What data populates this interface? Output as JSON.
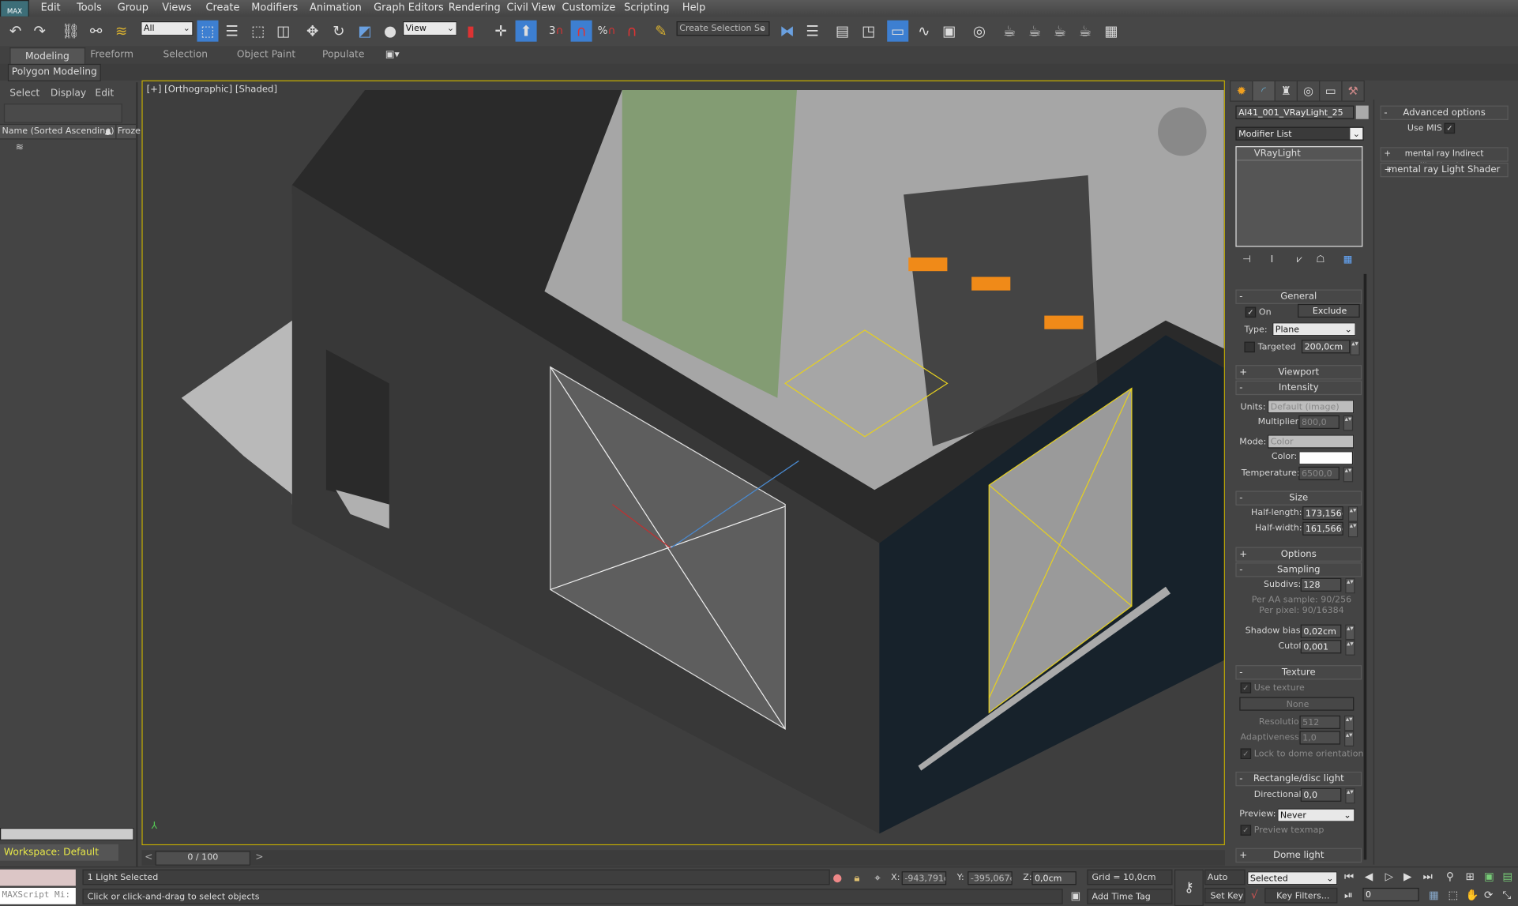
{
  "app": {
    "logo": "MAX"
  },
  "menu": [
    "Edit",
    "Tools",
    "Group",
    "Views",
    "Create",
    "Modifiers",
    "Animation",
    "Graph Editors",
    "Rendering",
    "Civil View",
    "Customize",
    "Scripting",
    "Help"
  ],
  "toolbar": {
    "filter_value": "All",
    "refcoord_value": "View",
    "snap_label": "3",
    "selection_set_placeholder": "Create Selection Se",
    "icons": [
      "undo-icon",
      "redo-icon",
      "link-icon",
      "unlink-icon",
      "bind-space-warp-icon",
      "select-object-icon",
      "select-by-name-icon",
      "rect-selection-icon",
      "window-crossing-icon",
      "move-icon",
      "rotate-icon",
      "scale-icon",
      "place-icon",
      "pivot-icon",
      "manipulate-icon",
      "keyboard-shortcut-icon",
      "snap-toggle-icon",
      "angle-snap-icon",
      "percent-snap-icon",
      "spinner-snap-icon",
      "edit-named-selection-icon",
      "mirror-icon",
      "align-icon",
      "layer-explorer-icon",
      "scene-explorer-icon",
      "toggle-ribbon-icon",
      "curve-editor-icon",
      "schematic-view-icon",
      "material-editor-icon",
      "render-setup-icon",
      "rendered-frame-window-icon",
      "render-icon",
      "render-iterative-icon",
      "render-cloud-icon"
    ]
  },
  "ribbon": {
    "tabs": [
      "Modeling",
      "Freeform",
      "Selection",
      "Object Paint",
      "Populate"
    ],
    "active_tab": "Modeling",
    "panel": "Polygon Modeling"
  },
  "scene_explorer": {
    "menu": [
      "Select",
      "Display",
      "Edit"
    ],
    "columns": [
      "Name (Sorted Ascending)",
      "Froze"
    ],
    "workspace": "Workspace: Default"
  },
  "viewport": {
    "label": "[+] [Orthographic] [Shaded]",
    "accent": "#c8b000"
  },
  "timeline": {
    "frame": "0 / 100",
    "prev": "<",
    "next": ">"
  },
  "command_panel": {
    "object_name": "AI41_001_VRayLight_25",
    "modifier_list": "Modifier List",
    "stack": [
      "VRayLight"
    ],
    "general": {
      "title": "General",
      "on_label": "On",
      "on_checked": true,
      "exclude": "Exclude",
      "type_label": "Type:",
      "type_value": "Plane",
      "targeted_label": "Targeted",
      "targeted_checked": false,
      "target_distance": "200,0cm"
    },
    "viewport_rollout": "Viewport",
    "intensity": {
      "title": "Intensity",
      "units_label": "Units:",
      "units_value": "Default (image)",
      "multiplier_label": "Multiplier:",
      "multiplier_value": "800,0",
      "mode_label": "Mode:",
      "mode_value": "Color",
      "color_label": "Color:",
      "color_value": "#ffffff",
      "temperature_label": "Temperature:",
      "temperature_value": "6500,0"
    },
    "size": {
      "title": "Size",
      "half_length_label": "Half-length:",
      "half_length_value": "173,156cı",
      "half_width_label": "Half-width:",
      "half_width_value": "161,566cı"
    },
    "options_rollout": "Options",
    "sampling": {
      "title": "Sampling",
      "subdivs_label": "Subdivs:",
      "subdivs_value": "128",
      "per_aa": "Per AA sample: 90/256",
      "per_pixel": "Per pixel: 90/16384",
      "shadow_bias_label": "Shadow bias:",
      "shadow_bias_value": "0,02cm",
      "cutoff_label": "Cutoff:",
      "cutoff_value": "0,001"
    },
    "texture": {
      "title": "Texture",
      "use_texture": "Use texture",
      "map_button": "None",
      "resolution_label": "Resolution:",
      "resolution_value": "512",
      "adaptiveness_label": "Adaptiveness:",
      "adaptiveness_value": "1,0",
      "lock_dome": "Lock to dome orientation"
    },
    "rect_disc": {
      "title": "Rectangle/disc light",
      "directional_label": "Directional:",
      "directional_value": "0,0",
      "preview_label": "Preview:",
      "preview_value": "Never",
      "preview_texmap": "Preview texmap"
    },
    "dome_rollout": "Dome light"
  },
  "extra_rollouts": {
    "advanced": "Advanced options",
    "use_mis": "Use MIS",
    "use_mis_checked": true,
    "mr_indirect": "mental ray Indirect Illumination",
    "mr_shader": "mental ray Light Shader"
  },
  "status": {
    "maxscript": "MAXScript Mi:",
    "selection": "1 Light Selected",
    "prompt": "Click or click-and-drag to select objects",
    "x_label": "X:",
    "x_value": "-943,791cr",
    "y_label": "Y:",
    "y_value": "-395,067cr",
    "z_label": "Z:",
    "z_value": "0,0cm",
    "grid": "Grid = 10,0cm",
    "add_time_tag": "Add Time Tag",
    "auto_key": "Auto Key",
    "set_key": "Set Key",
    "key_mode": "Selected",
    "key_filters": "Key Filters...",
    "current_frame": "0"
  }
}
